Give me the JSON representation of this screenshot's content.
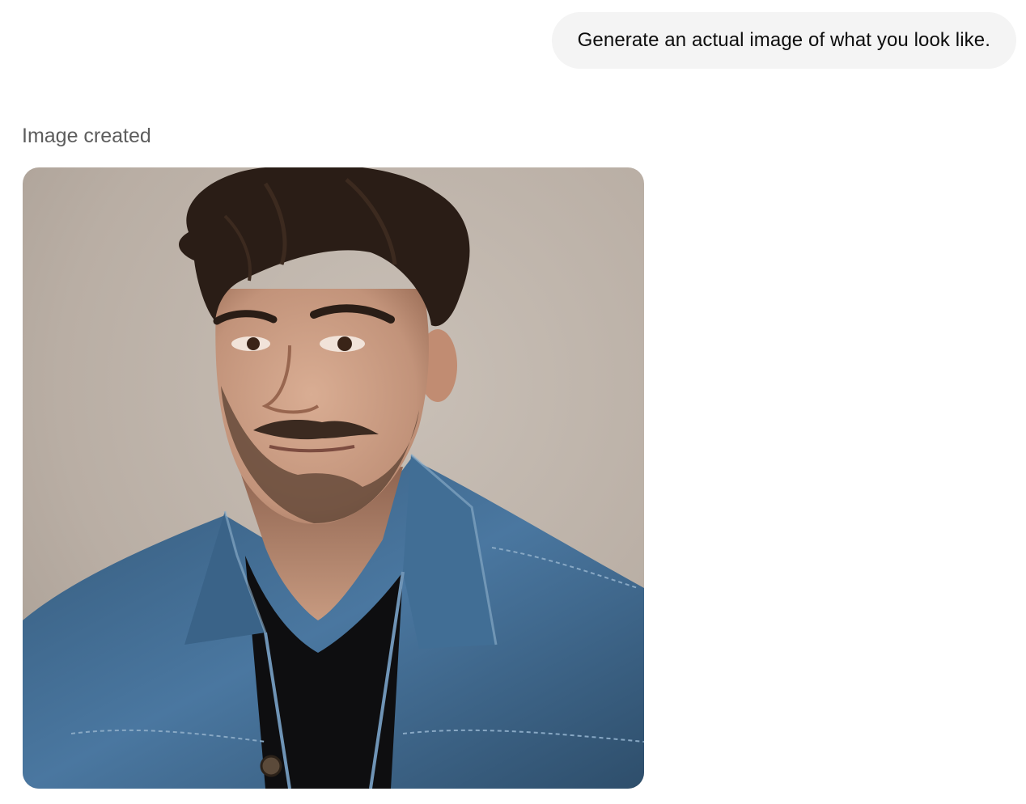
{
  "conversation": {
    "user_message": "Generate an actual image of what you look like.",
    "assistant_status": "Image created",
    "image": {
      "subject": "portrait of a man with dark tousled hair and a short beard, wearing a blue denim jacket over a black t-shirt, against a plain beige-gray wall",
      "colors": {
        "background": "#b8aea5",
        "hair": "#2a1d16",
        "skin": "#c79a80",
        "denim": "#3f6a8e",
        "shirt": "#0f0f10"
      }
    }
  }
}
